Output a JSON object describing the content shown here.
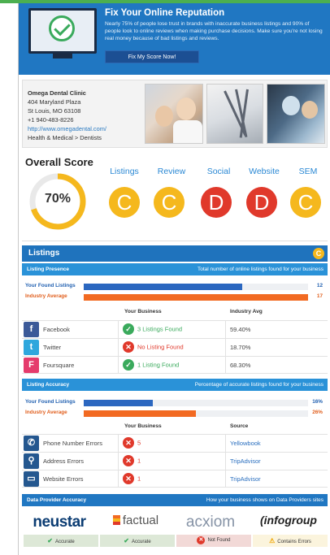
{
  "hero": {
    "title": "Fix Your Online Reputation",
    "text": "Nearly 75% of people lose trust in brands with inaccurate business listings and 90% of people look to online reviews when making purchase decisions. Make sure you're not losing real money because of bad listings and reviews.",
    "cta": "Fix My Score Now!"
  },
  "clinic": {
    "name": "Omega Dental Clinic",
    "address1": "404 Maryland Plaza",
    "address2": "St Louis, MO 63108",
    "phone": "+1 940-483-8226",
    "url": "http://www.omegadental.com/",
    "category": "Health & Medical > Dentists"
  },
  "overall": {
    "title": "Overall Score",
    "percent": "70%",
    "percent_value": 0.7,
    "categories": [
      {
        "label": "Listings",
        "grade": "C",
        "color": "#f5b81d"
      },
      {
        "label": "Review",
        "grade": "C",
        "color": "#f5b81d"
      },
      {
        "label": "Social",
        "grade": "D",
        "color": "#e0392b"
      },
      {
        "label": "Website",
        "grade": "D",
        "color": "#e0392b"
      },
      {
        "label": "SEM",
        "grade": "C",
        "color": "#f5b81d"
      }
    ]
  },
  "listings": {
    "title": "Listings",
    "grade": "C",
    "presence": {
      "title": "Listing Presence",
      "desc": "Total number of online listings found for your business",
      "found_label": "Your Found Listings",
      "found_value": "12",
      "found_fraction": 0.706,
      "avg_label": "Industry Average",
      "avg_value": "17",
      "avg_fraction": 1.0,
      "col_business": "Your Business",
      "col_avg": "Industry Avg",
      "rows": [
        {
          "name": "Facebook",
          "status": "3 Listings Found",
          "ok": true,
          "avg": "59.40%",
          "icon": "facebook-icon",
          "glyph": "f",
          "color": "#3b5998"
        },
        {
          "name": "Twitter",
          "status": "No Listing Found",
          "ok": false,
          "avg": "18.70%",
          "icon": "twitter-icon",
          "glyph": "t",
          "color": "#2fa7dd"
        },
        {
          "name": "Foursquare",
          "status": "1 Listing Found",
          "ok": true,
          "avg": "68.30%",
          "icon": "foursquare-icon",
          "glyph": "F",
          "color": "#e53b6c"
        }
      ]
    },
    "accuracy": {
      "title": "Listing Accuracy",
      "desc": "Percentage of accurate listings found for your business",
      "found_label": "Your Found Listings",
      "found_value": "16%",
      "found_fraction": 0.16,
      "avg_label": "Industry Average",
      "avg_value": "26%",
      "avg_fraction": 0.26,
      "col_business": "Your Business",
      "col_source": "Source",
      "rows": [
        {
          "name": "Phone Number Errors",
          "count": "5",
          "source": "Yellowbook",
          "icon": "phone-icon",
          "glyph": "✆"
        },
        {
          "name": "Address Errors",
          "count": "1",
          "source": "TripAdvisor",
          "icon": "map-pin-icon",
          "glyph": "⚲"
        },
        {
          "name": "Website Errors",
          "count": "1",
          "source": "TripAdvisor",
          "icon": "monitor-icon",
          "glyph": "▭"
        }
      ]
    }
  },
  "providers": {
    "title": "Data Provider Accuracy",
    "desc": "How your business shows on Data Providers sites",
    "items": [
      {
        "name": "neustar",
        "status": "Accurate",
        "state": "ok"
      },
      {
        "name": "factual",
        "status": "Accurate",
        "state": "ok"
      },
      {
        "name": "acxiom",
        "status": "Not Found",
        "state": "bad"
      },
      {
        "name": "infogroup",
        "status": "Contains Errors",
        "state": "warn"
      }
    ]
  }
}
